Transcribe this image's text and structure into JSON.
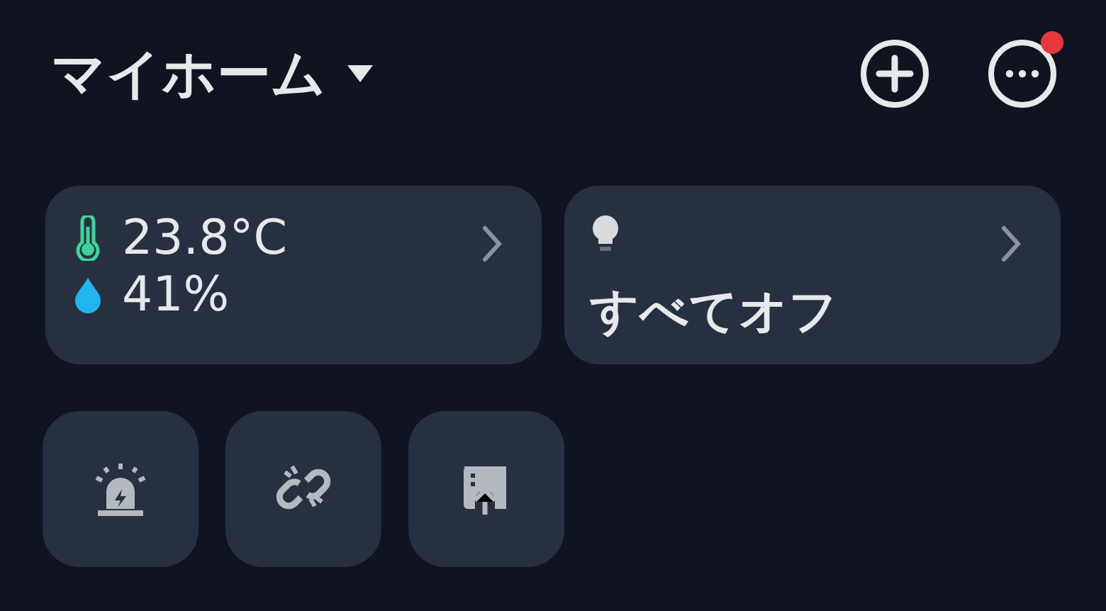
{
  "header": {
    "title": "マイホーム",
    "menu_badge": true
  },
  "climate_card": {
    "temperature": "23.8°C",
    "humidity": "41%"
  },
  "lights_card": {
    "status": "すべてオフ"
  },
  "quick_actions": [
    {
      "kind": "alarm"
    },
    {
      "kind": "unlink"
    },
    {
      "kind": "upload"
    }
  ]
}
